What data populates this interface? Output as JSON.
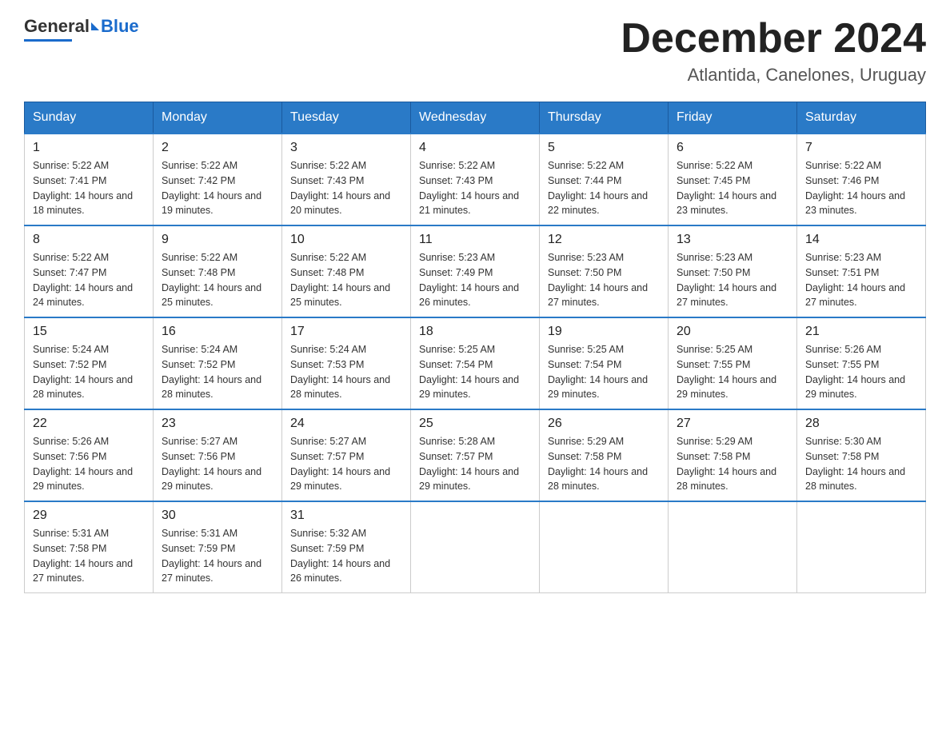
{
  "header": {
    "logo_general": "General",
    "logo_blue": "Blue",
    "month_title": "December 2024",
    "location": "Atlantida, Canelones, Uruguay"
  },
  "weekdays": [
    "Sunday",
    "Monday",
    "Tuesday",
    "Wednesday",
    "Thursday",
    "Friday",
    "Saturday"
  ],
  "weeks": [
    [
      {
        "day": "1",
        "sunrise": "5:22 AM",
        "sunset": "7:41 PM",
        "daylight": "14 hours and 18 minutes."
      },
      {
        "day": "2",
        "sunrise": "5:22 AM",
        "sunset": "7:42 PM",
        "daylight": "14 hours and 19 minutes."
      },
      {
        "day": "3",
        "sunrise": "5:22 AM",
        "sunset": "7:43 PM",
        "daylight": "14 hours and 20 minutes."
      },
      {
        "day": "4",
        "sunrise": "5:22 AM",
        "sunset": "7:43 PM",
        "daylight": "14 hours and 21 minutes."
      },
      {
        "day": "5",
        "sunrise": "5:22 AM",
        "sunset": "7:44 PM",
        "daylight": "14 hours and 22 minutes."
      },
      {
        "day": "6",
        "sunrise": "5:22 AM",
        "sunset": "7:45 PM",
        "daylight": "14 hours and 23 minutes."
      },
      {
        "day": "7",
        "sunrise": "5:22 AM",
        "sunset": "7:46 PM",
        "daylight": "14 hours and 23 minutes."
      }
    ],
    [
      {
        "day": "8",
        "sunrise": "5:22 AM",
        "sunset": "7:47 PM",
        "daylight": "14 hours and 24 minutes."
      },
      {
        "day": "9",
        "sunrise": "5:22 AM",
        "sunset": "7:48 PM",
        "daylight": "14 hours and 25 minutes."
      },
      {
        "day": "10",
        "sunrise": "5:22 AM",
        "sunset": "7:48 PM",
        "daylight": "14 hours and 25 minutes."
      },
      {
        "day": "11",
        "sunrise": "5:23 AM",
        "sunset": "7:49 PM",
        "daylight": "14 hours and 26 minutes."
      },
      {
        "day": "12",
        "sunrise": "5:23 AM",
        "sunset": "7:50 PM",
        "daylight": "14 hours and 27 minutes."
      },
      {
        "day": "13",
        "sunrise": "5:23 AM",
        "sunset": "7:50 PM",
        "daylight": "14 hours and 27 minutes."
      },
      {
        "day": "14",
        "sunrise": "5:23 AM",
        "sunset": "7:51 PM",
        "daylight": "14 hours and 27 minutes."
      }
    ],
    [
      {
        "day": "15",
        "sunrise": "5:24 AM",
        "sunset": "7:52 PM",
        "daylight": "14 hours and 28 minutes."
      },
      {
        "day": "16",
        "sunrise": "5:24 AM",
        "sunset": "7:52 PM",
        "daylight": "14 hours and 28 minutes."
      },
      {
        "day": "17",
        "sunrise": "5:24 AM",
        "sunset": "7:53 PM",
        "daylight": "14 hours and 28 minutes."
      },
      {
        "day": "18",
        "sunrise": "5:25 AM",
        "sunset": "7:54 PM",
        "daylight": "14 hours and 29 minutes."
      },
      {
        "day": "19",
        "sunrise": "5:25 AM",
        "sunset": "7:54 PM",
        "daylight": "14 hours and 29 minutes."
      },
      {
        "day": "20",
        "sunrise": "5:25 AM",
        "sunset": "7:55 PM",
        "daylight": "14 hours and 29 minutes."
      },
      {
        "day": "21",
        "sunrise": "5:26 AM",
        "sunset": "7:55 PM",
        "daylight": "14 hours and 29 minutes."
      }
    ],
    [
      {
        "day": "22",
        "sunrise": "5:26 AM",
        "sunset": "7:56 PM",
        "daylight": "14 hours and 29 minutes."
      },
      {
        "day": "23",
        "sunrise": "5:27 AM",
        "sunset": "7:56 PM",
        "daylight": "14 hours and 29 minutes."
      },
      {
        "day": "24",
        "sunrise": "5:27 AM",
        "sunset": "7:57 PM",
        "daylight": "14 hours and 29 minutes."
      },
      {
        "day": "25",
        "sunrise": "5:28 AM",
        "sunset": "7:57 PM",
        "daylight": "14 hours and 29 minutes."
      },
      {
        "day": "26",
        "sunrise": "5:29 AM",
        "sunset": "7:58 PM",
        "daylight": "14 hours and 28 minutes."
      },
      {
        "day": "27",
        "sunrise": "5:29 AM",
        "sunset": "7:58 PM",
        "daylight": "14 hours and 28 minutes."
      },
      {
        "day": "28",
        "sunrise": "5:30 AM",
        "sunset": "7:58 PM",
        "daylight": "14 hours and 28 minutes."
      }
    ],
    [
      {
        "day": "29",
        "sunrise": "5:31 AM",
        "sunset": "7:58 PM",
        "daylight": "14 hours and 27 minutes."
      },
      {
        "day": "30",
        "sunrise": "5:31 AM",
        "sunset": "7:59 PM",
        "daylight": "14 hours and 27 minutes."
      },
      {
        "day": "31",
        "sunrise": "5:32 AM",
        "sunset": "7:59 PM",
        "daylight": "14 hours and 26 minutes."
      },
      null,
      null,
      null,
      null
    ]
  ]
}
